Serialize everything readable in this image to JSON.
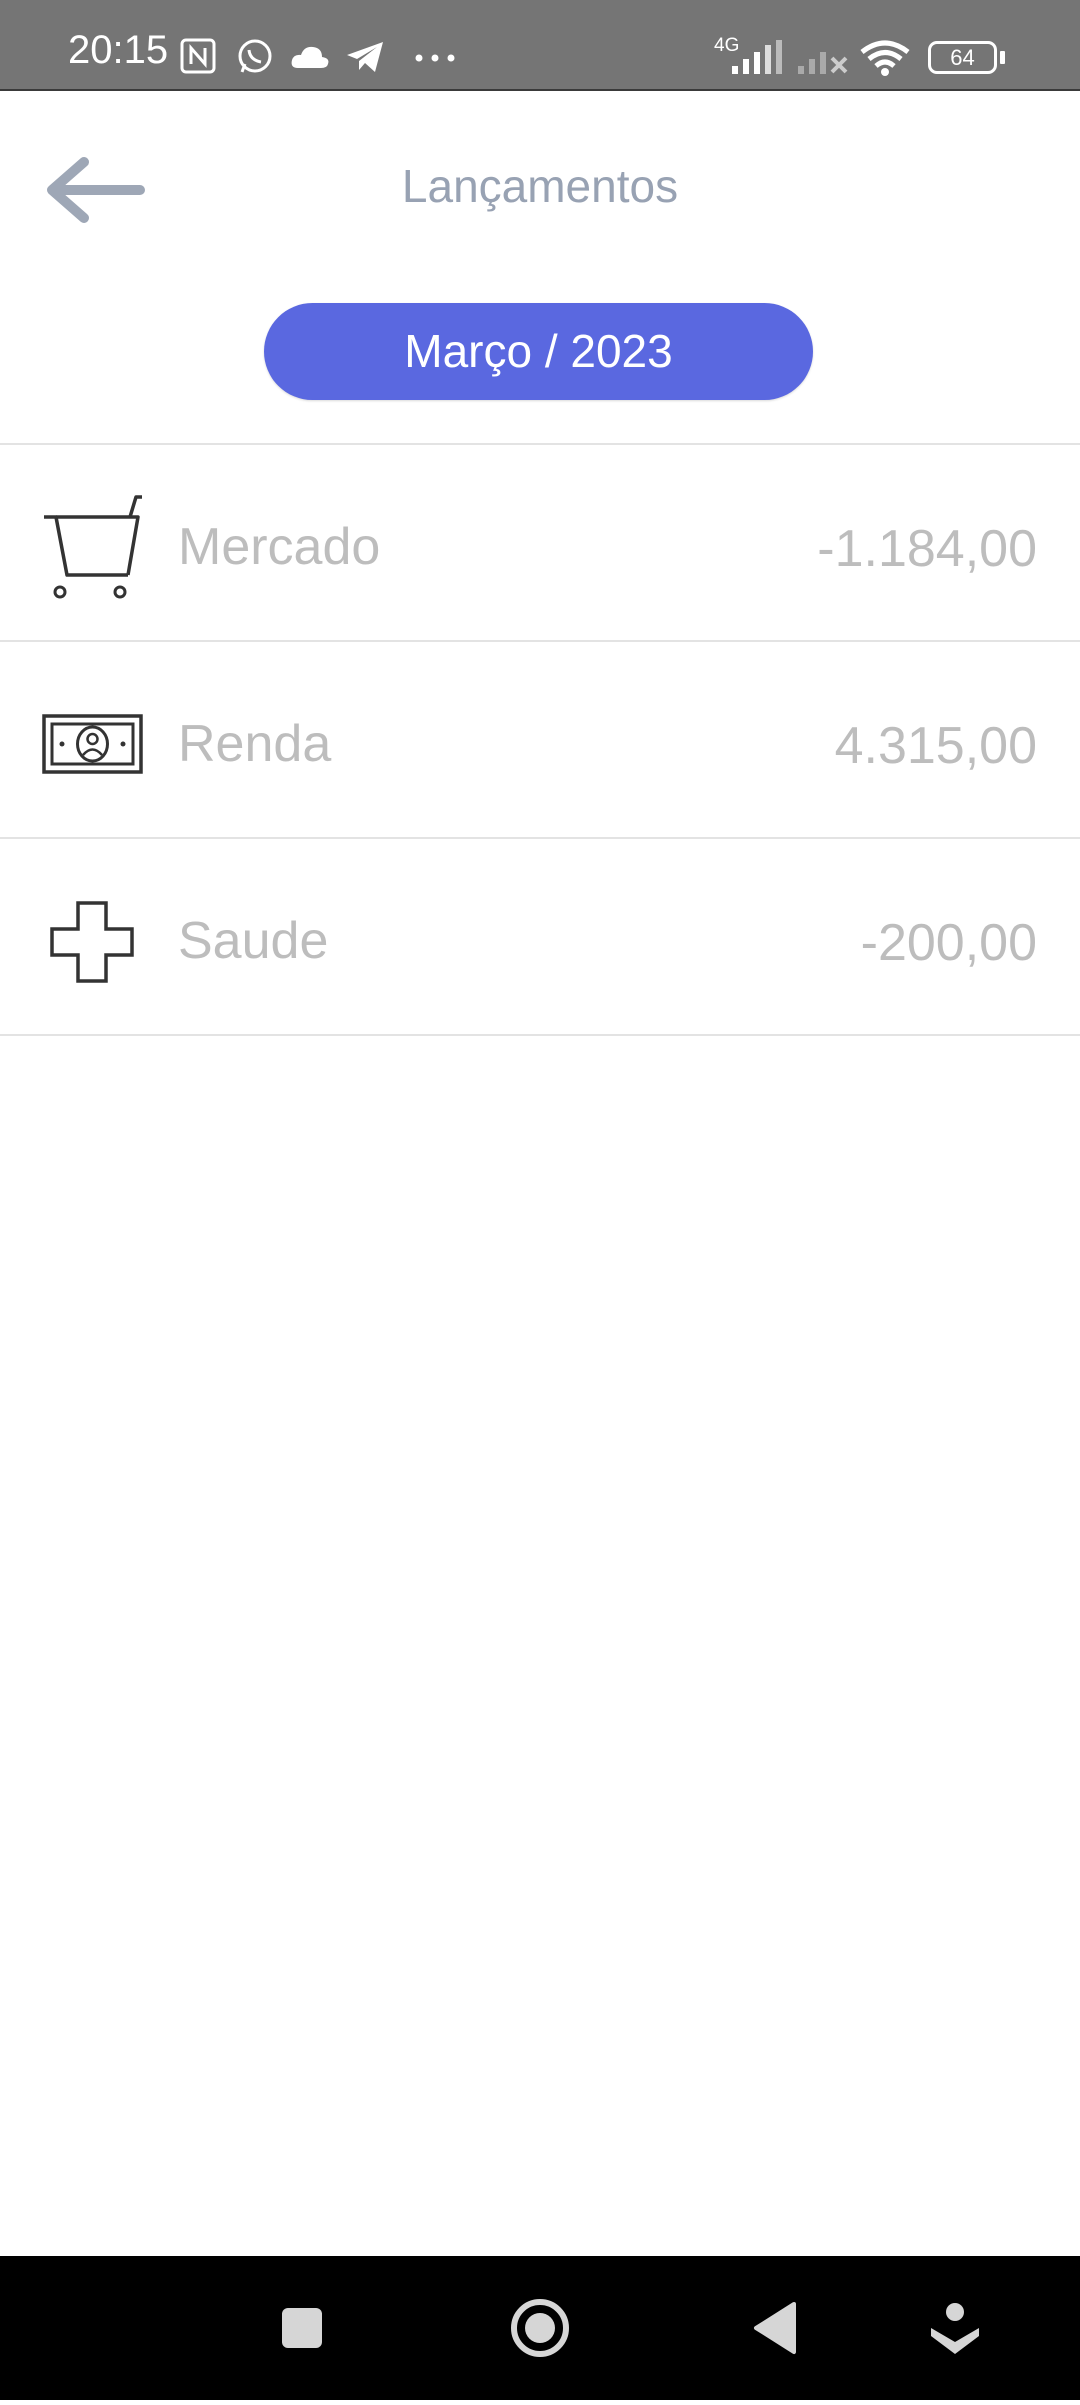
{
  "status_bar": {
    "time": "20:15",
    "network_label": "4G",
    "battery": "64",
    "icons": [
      "nfc-icon",
      "whatsapp-icon",
      "cloud-icon",
      "telegram-icon",
      "more-dots-icon",
      "signal-icon",
      "signal-off-icon",
      "wifi-icon",
      "battery-icon"
    ]
  },
  "header": {
    "title": "Lançamentos",
    "back_icon": "arrow-left-icon"
  },
  "month_selector": {
    "label": "Março / 2023"
  },
  "entries": [
    {
      "icon": "shopping-cart-icon",
      "label": "Mercado",
      "value": "-1.184,00"
    },
    {
      "icon": "banknote-icon",
      "label": "Renda",
      "value": "4.315,00"
    },
    {
      "icon": "health-cross-icon",
      "label": "Saude",
      "value": "-200,00"
    }
  ],
  "nav_bar": {
    "icons": [
      "recents-square-icon",
      "home-circle-icon",
      "back-triangle-icon",
      "assistant-icon"
    ]
  },
  "colors": {
    "status_bar_bg": "#757575",
    "accent": "#5a68e0",
    "title": "#98a2b3",
    "row_text": "#bdbdbd",
    "divider": "#e3e3e3",
    "nav_bar_bg": "#000000"
  }
}
